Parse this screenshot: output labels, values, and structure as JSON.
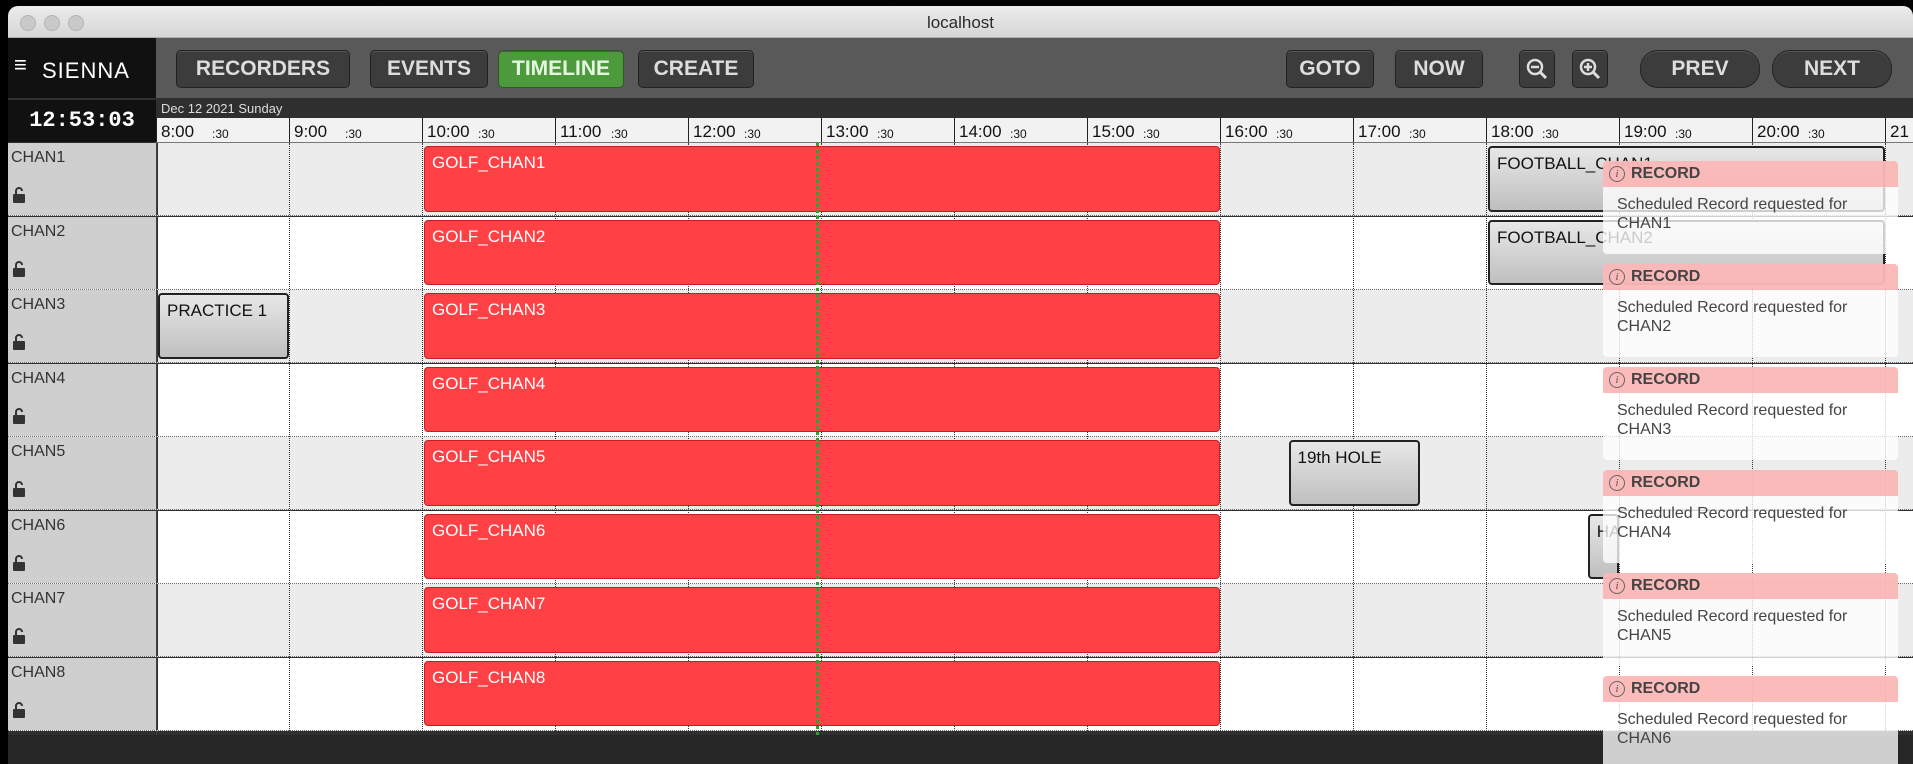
{
  "window": {
    "title": "localhost"
  },
  "toolbar": {
    "logo": "SIENNA",
    "recorders": "RECORDERS",
    "events": "EVENTS",
    "timeline": "TIMELINE",
    "create": "CREATE",
    "goto": "GOTO",
    "now": "NOW",
    "prev": "PREV",
    "next": "NEXT"
  },
  "clock": "12:53:03",
  "date": "Dec 12 2021 Sunday",
  "timeline": {
    "hours": [
      "8:00",
      "9:00",
      "10:00",
      "11:00",
      "12:00",
      "13:00",
      "14:00",
      "15:00",
      "16:00",
      "17:00",
      "18:00",
      "19:00",
      "20:00",
      "21"
    ],
    "half": ":30"
  },
  "channels": [
    {
      "name": "CHAN1"
    },
    {
      "name": "CHAN2"
    },
    {
      "name": "CHAN3"
    },
    {
      "name": "CHAN4"
    },
    {
      "name": "CHAN5"
    },
    {
      "name": "CHAN6"
    },
    {
      "name": "CHAN7"
    },
    {
      "name": "CHAN8"
    }
  ],
  "events": [
    {
      "label": "GOLF_CHAN1",
      "channel": "CHAN1",
      "start": "10:00",
      "end": "16:00",
      "style": "recording"
    },
    {
      "label": "GOLF_CHAN2",
      "channel": "CHAN2",
      "start": "10:00",
      "end": "16:00",
      "style": "recording"
    },
    {
      "label": "GOLF_CHAN3",
      "channel": "CHAN3",
      "start": "10:00",
      "end": "16:00",
      "style": "recording"
    },
    {
      "label": "GOLF_CHAN4",
      "channel": "CHAN4",
      "start": "10:00",
      "end": "16:00",
      "style": "recording"
    },
    {
      "label": "GOLF_CHAN5",
      "channel": "CHAN5",
      "start": "10:00",
      "end": "16:00",
      "style": "recording"
    },
    {
      "label": "GOLF_CHAN6",
      "channel": "CHAN6",
      "start": "10:00",
      "end": "16:00",
      "style": "recording"
    },
    {
      "label": "GOLF_CHAN7",
      "channel": "CHAN7",
      "start": "10:00",
      "end": "16:00",
      "style": "recording"
    },
    {
      "label": "GOLF_CHAN8",
      "channel": "CHAN8",
      "start": "10:00",
      "end": "16:00",
      "style": "recording"
    },
    {
      "label": "PRACTICE 1",
      "channel": "CHAN3",
      "start": "8:00",
      "end": "9:00",
      "style": "scheduled"
    },
    {
      "label": "19th HOLE",
      "channel": "CHAN5",
      "start": "16:30",
      "end": "17:30",
      "style": "scheduled"
    },
    {
      "label": "FOOTBALL_CHAN1",
      "channel": "CHAN1",
      "start": "18:00",
      "end": "21:00",
      "style": "scheduled"
    },
    {
      "label": "FOOTBALL_CHAN2",
      "channel": "CHAN2",
      "start": "18:00",
      "end": "21:00",
      "style": "scheduled"
    },
    {
      "label": "HA AN",
      "channel": "CHAN6",
      "start": "18:45",
      "end": "19:00",
      "style": "scheduled"
    }
  ],
  "now_time": "12:53:03",
  "notifications": [
    {
      "title": "RECORD",
      "message": "Scheduled Record requested for CHAN1"
    },
    {
      "title": "RECORD",
      "message": "Scheduled Record requested for CHAN2"
    },
    {
      "title": "RECORD",
      "message": "Scheduled Record requested for CHAN3"
    },
    {
      "title": "RECORD",
      "message": "Scheduled Record requested for CHAN4"
    },
    {
      "title": "RECORD",
      "message": "Scheduled Record requested for CHAN5"
    },
    {
      "title": "RECORD",
      "message": "Scheduled Record requested for CHAN6"
    }
  ],
  "colors": {
    "recording": "#ff4145",
    "active_tab": "#4d9a3c",
    "now_line": "#2fa12f"
  }
}
